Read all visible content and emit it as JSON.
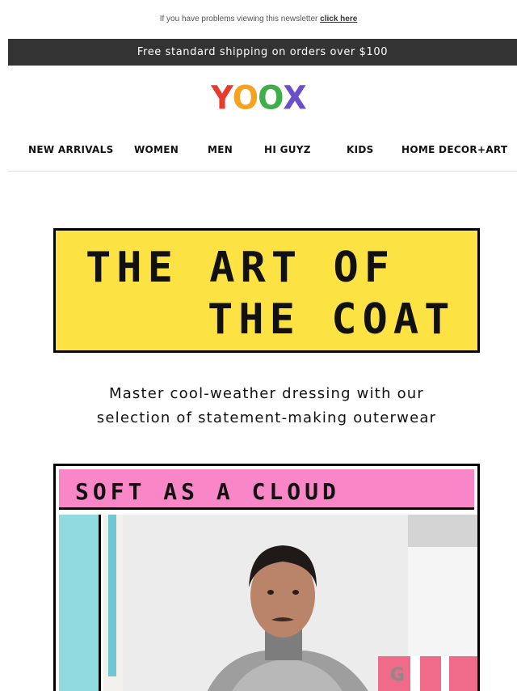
{
  "preheader": {
    "text": "If you have problems viewing this newsletter",
    "link": "click here"
  },
  "shipping_bar": {
    "text": "Free standard shipping on orders over $100"
  },
  "logo": {
    "letters": [
      "Y",
      "O",
      "O",
      "X"
    ],
    "colors": [
      "#e63b2e",
      "#f4a21f",
      "#3fae49",
      "#6a4fc8"
    ]
  },
  "nav": {
    "items": [
      {
        "label": "NEW ARRIVALS"
      },
      {
        "label": "WOMEN"
      },
      {
        "label": "MEN"
      },
      {
        "label": "HI GUYZ"
      },
      {
        "label": "KIDS"
      },
      {
        "label": "HOME DECOR+ART"
      }
    ]
  },
  "hero": {
    "line1": "THE ART OF",
    "line2": "THE COAT",
    "background": "#fde244"
  },
  "subtitle": {
    "line1": "Master cool-weather dressing with our",
    "line2": "selection of statement-making outerwear"
  },
  "card": {
    "title": "SOFT AS A CLOUD",
    "header_color": "#f986c6",
    "side_color": "#8fdbe0"
  }
}
